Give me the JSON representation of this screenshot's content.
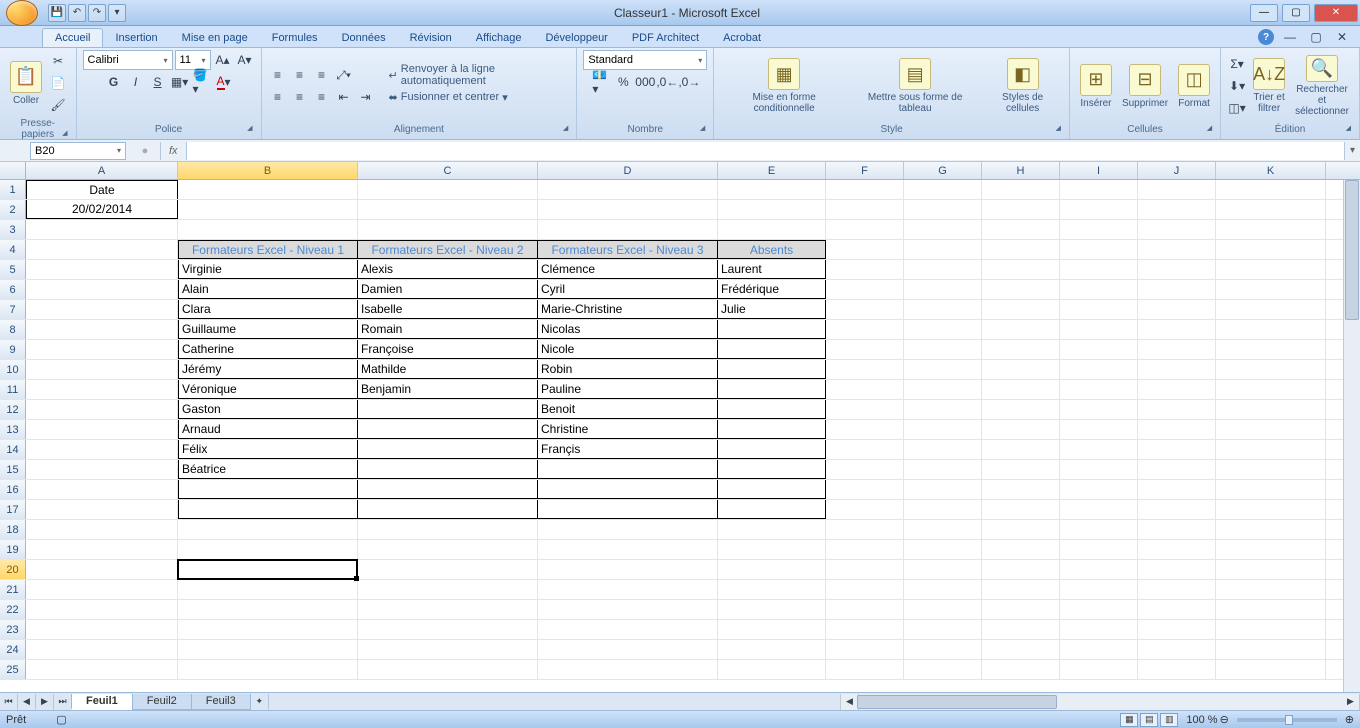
{
  "title": "Classeur1 - Microsoft Excel",
  "tabs": [
    "Accueil",
    "Insertion",
    "Mise en page",
    "Formules",
    "Données",
    "Révision",
    "Affichage",
    "Développeur",
    "PDF Architect",
    "Acrobat"
  ],
  "activeTab": "Accueil",
  "ribbon": {
    "clipboard": {
      "paste": "Coller",
      "label": "Presse-papiers"
    },
    "font": {
      "name": "Calibri",
      "size": "11",
      "label": "Police",
      "bold": "G",
      "italic": "I",
      "underline": "S"
    },
    "alignment": {
      "wrap": "Renvoyer à la ligne automatiquement",
      "merge": "Fusionner et centrer",
      "label": "Alignement"
    },
    "number": {
      "format": "Standard",
      "label": "Nombre"
    },
    "style": {
      "cond": "Mise en forme conditionnelle",
      "table": "Mettre sous forme de tableau",
      "cell": "Styles de cellules",
      "label": "Style"
    },
    "cells": {
      "insert": "Insérer",
      "delete": "Supprimer",
      "format": "Format",
      "label": "Cellules"
    },
    "editing": {
      "sort": "Trier et filtrer",
      "find": "Rechercher et sélectionner",
      "label": "Édition"
    }
  },
  "nameBox": "B20",
  "columns": [
    {
      "letter": "A",
      "width": 152
    },
    {
      "letter": "B",
      "width": 180
    },
    {
      "letter": "C",
      "width": 180
    },
    {
      "letter": "D",
      "width": 180
    },
    {
      "letter": "E",
      "width": 108
    },
    {
      "letter": "F",
      "width": 78
    },
    {
      "letter": "G",
      "width": 78
    },
    {
      "letter": "H",
      "width": 78
    },
    {
      "letter": "I",
      "width": 78
    },
    {
      "letter": "J",
      "width": 78
    },
    {
      "letter": "K",
      "width": 110
    }
  ],
  "selectedCol": "B",
  "selectedRow": 20,
  "rowCount": 25,
  "cells": {
    "A1": "Date",
    "A2": "20/02/2014",
    "B4": "Formateurs Excel - Niveau 1",
    "C4": "Formateurs Excel - Niveau 2",
    "D4": "Formateurs Excel - Niveau 3",
    "E4": "Absents",
    "B5": "Virginie",
    "C5": "Alexis",
    "D5": "Clémence",
    "E5": "Laurent",
    "B6": "Alain",
    "C6": "Damien",
    "D6": "Cyril",
    "E6": "Frédérique",
    "B7": "Clara",
    "C7": "Isabelle",
    "D7": "Marie-Christine",
    "E7": "Julie",
    "B8": "Guillaume",
    "C8": "Romain",
    "D8": "Nicolas",
    "B9": "Catherine",
    "C9": "Françoise",
    "D9": "Nicole",
    "B10": "Jérémy",
    "C10": "Mathilde",
    "D10": "Robin",
    "B11": "Véronique",
    "C11": "Benjamin",
    "D11": "Pauline",
    "B12": "Gaston",
    "D12": "Benoit",
    "B13": "Arnaud",
    "D13": "Christine",
    "B14": "Félix",
    "D14": "Françis",
    "B15": "Béatrice"
  },
  "sheets": [
    "Feuil1",
    "Feuil2",
    "Feuil3"
  ],
  "activeSheet": "Feuil1",
  "status": "Prêt",
  "zoom": "100 %"
}
